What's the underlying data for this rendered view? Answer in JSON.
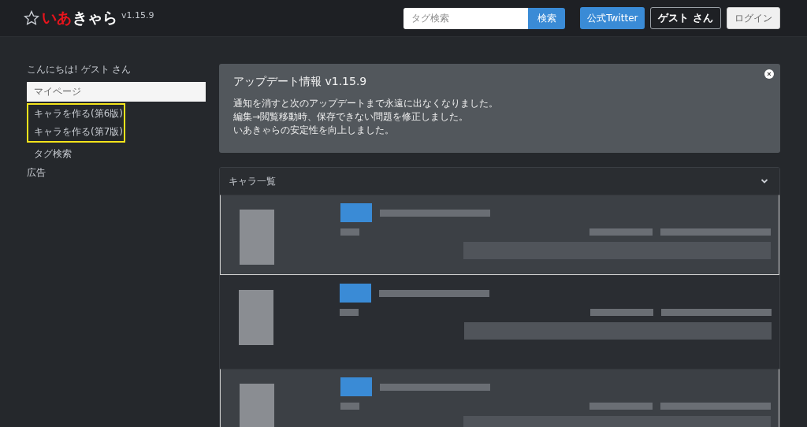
{
  "header": {
    "logo": {
      "parts": [
        {
          "text": "いあ",
          "color": "#e8141c"
        },
        {
          "text": "きゃら",
          "color": "#ffffff"
        }
      ],
      "version": "v1.15.9"
    },
    "search": {
      "placeholder": "タグ検索",
      "button": "検索"
    },
    "buttons": [
      {
        "label": "公式Twitter",
        "kind": "primary"
      },
      {
        "label": "ゲスト さん",
        "kind": "outline"
      },
      {
        "label": "ログイン",
        "kind": "light"
      }
    ]
  },
  "sidebar": {
    "greeting": "こんにちは! ゲスト さん",
    "items": [
      {
        "label": "マイページ",
        "kind": "box",
        "highlighted": false
      },
      {
        "label": "キャラを作る(第6版)",
        "kind": "link",
        "highlighted": true
      },
      {
        "label": "キャラを作る(第7版)",
        "kind": "link",
        "highlighted": true
      },
      {
        "label": "タグ検索",
        "kind": "link",
        "highlighted": false
      },
      {
        "label": "広告",
        "kind": "heading",
        "highlighted": false
      }
    ]
  },
  "update_notice": {
    "title": "アップデート情報 v1.15.9",
    "close": "×",
    "lines": [
      "通知を消すと次のアップデートまで永遠に出なくなりました。",
      "編集→閲覧移動時、保存できない問題を修正しました。",
      "いあきゃらの安定性を向上しました。"
    ]
  },
  "character_list": {
    "title": "キャラ一覧",
    "expanded": true,
    "rows": [
      {
        "kind": "blurred",
        "shaded": true
      },
      {
        "kind": "blurred",
        "shaded": false
      },
      {
        "kind": "blurred",
        "shaded": true
      }
    ]
  }
}
